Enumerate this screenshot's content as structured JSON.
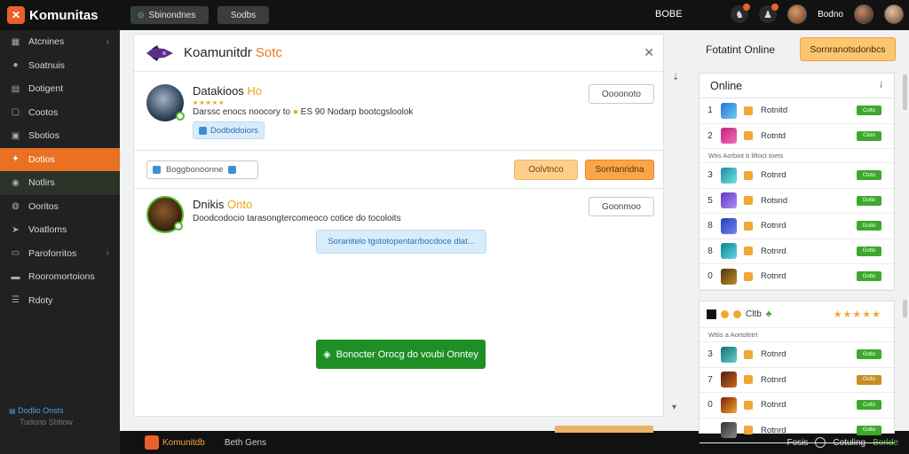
{
  "topbar": {
    "brand": "Komunitas",
    "tab1": "Sbinondnes",
    "tab2": "Sodbs",
    "center_label": "BOBE",
    "user_name": "Bodno"
  },
  "sidebar": {
    "items": [
      {
        "label": "Atcnines",
        "icon": "grid-icon",
        "chevron": true
      },
      {
        "label": "Soatnuis",
        "icon": "circle-icon",
        "chevron": false
      },
      {
        "label": "Dotigent",
        "icon": "doc-icon",
        "chevron": false
      },
      {
        "label": "Cootos",
        "icon": "box-icon",
        "chevron": false
      },
      {
        "label": "Sbotios",
        "icon": "chat-icon",
        "chevron": false
      },
      {
        "label": "Dotios",
        "icon": "game-icon",
        "chevron": false,
        "active": true
      },
      {
        "label": "Notlirs",
        "icon": "globe-icon",
        "chevron": false,
        "sub": true
      },
      {
        "label": "Ooritos",
        "icon": "users-icon",
        "chevron": false
      },
      {
        "label": "Voatloms",
        "icon": "send-icon",
        "chevron": false
      },
      {
        "label": "Paroforritos",
        "icon": "folder-icon",
        "chevron": true
      },
      {
        "label": "Rooromortoions",
        "icon": "tag-icon",
        "chevron": false
      },
      {
        "label": "Rdoty",
        "icon": "list-icon",
        "chevron": false
      }
    ],
    "footer_link": "Dodlio Onsts",
    "footer_sub": "Tudono Sbtiow"
  },
  "main": {
    "title_plain": "Koamunitdr",
    "title_highlight": "Sotc",
    "post1": {
      "name": "Datakioos",
      "name_highlight": "Ho",
      "text": "Darssc enocs noocory to",
      "text2": "ES 90 Nodarp bootcgsloolok",
      "chip": "Dodbddoiors",
      "button": "Oooonoto"
    },
    "toolbar": {
      "tag": "Boggbonoonne",
      "btn_a": "Oolvtnco",
      "btn_b": "Sorrtanridna"
    },
    "post2": {
      "name": "Dnikis",
      "name_highlight": "Onto",
      "text": "Doodcodocio tarasongtercomeoco cotice do tocoloits",
      "chip": "Soranitelo tgstotopentar/bocdoce dlat...",
      "button": "Goonmoo"
    },
    "cta": "Bonocter Orocg do voubi Onntey"
  },
  "statusbar": {
    "brand": "Komunitdb",
    "mid": "Beth Gens",
    "right1": "Fosis",
    "right2": "Cotuling",
    "right3": "Borlde"
  },
  "right": {
    "header": "Fotatint Online",
    "gold_button": "Sornranotsdonbcs",
    "online_title": "Online",
    "online_rows": [
      {
        "rank": "1",
        "name": "Rotnitd",
        "badge": "Colto",
        "colors": [
          "#2b6fd6",
          "#6ad0f0"
        ]
      },
      {
        "rank": "2",
        "name": "Rotntd",
        "badge": "Cloin",
        "colors": [
          "#c2247e",
          "#f26dbb"
        ]
      },
      {
        "rank": "3",
        "name": "Rotnrd",
        "badge": "Ctoto",
        "colors": [
          "#1b8ca8",
          "#72e3d9"
        ]
      },
      {
        "rank": "5",
        "name": "Rotsnd",
        "badge": "Gotto",
        "colors": [
          "#5b3bc4",
          "#b38cf2"
        ]
      },
      {
        "rank": "8",
        "name": "Rotnrd",
        "badge": "Gotto",
        "colors": [
          "#2241b8",
          "#7a84f2"
        ]
      },
      {
        "rank": "8",
        "name": "Rotnrd",
        "badge": "Gotto",
        "colors": [
          "#0d7f91",
          "#5fd9e8"
        ]
      },
      {
        "rank": "0",
        "name": "Rotnrd",
        "badge": "Gotto",
        "colors": [
          "#4a3a10",
          "#c58a24"
        ]
      }
    ],
    "online_subline": "Wtis Aorbiot b liftoct toets",
    "group_label": "Cltb",
    "group_subline": "Wttis a Aortoltrtrt",
    "group_rows": [
      {
        "rank": "3",
        "name": "Rotnrd",
        "badge": "Golto",
        "gold": false,
        "colors": [
          "#126d7d",
          "#64d3c4"
        ]
      },
      {
        "rank": "7",
        "name": "Rotnrd",
        "badge": "Oclto",
        "gold": true,
        "colors": [
          "#4a1e0b",
          "#d06a22"
        ]
      },
      {
        "rank": "0",
        "name": "Rotnrd",
        "badge": "Colto",
        "gold": false,
        "colors": [
          "#7d1d0b",
          "#f2a62a"
        ]
      },
      {
        "rank": "",
        "name": "Rotnrd",
        "badge": "Golto",
        "gold": false,
        "colors": [
          "#333",
          "#888"
        ]
      }
    ]
  },
  "colors": {
    "accent_orange": "#e87222",
    "online_green": "#3ca82c",
    "cta_green": "#1f8f25"
  }
}
